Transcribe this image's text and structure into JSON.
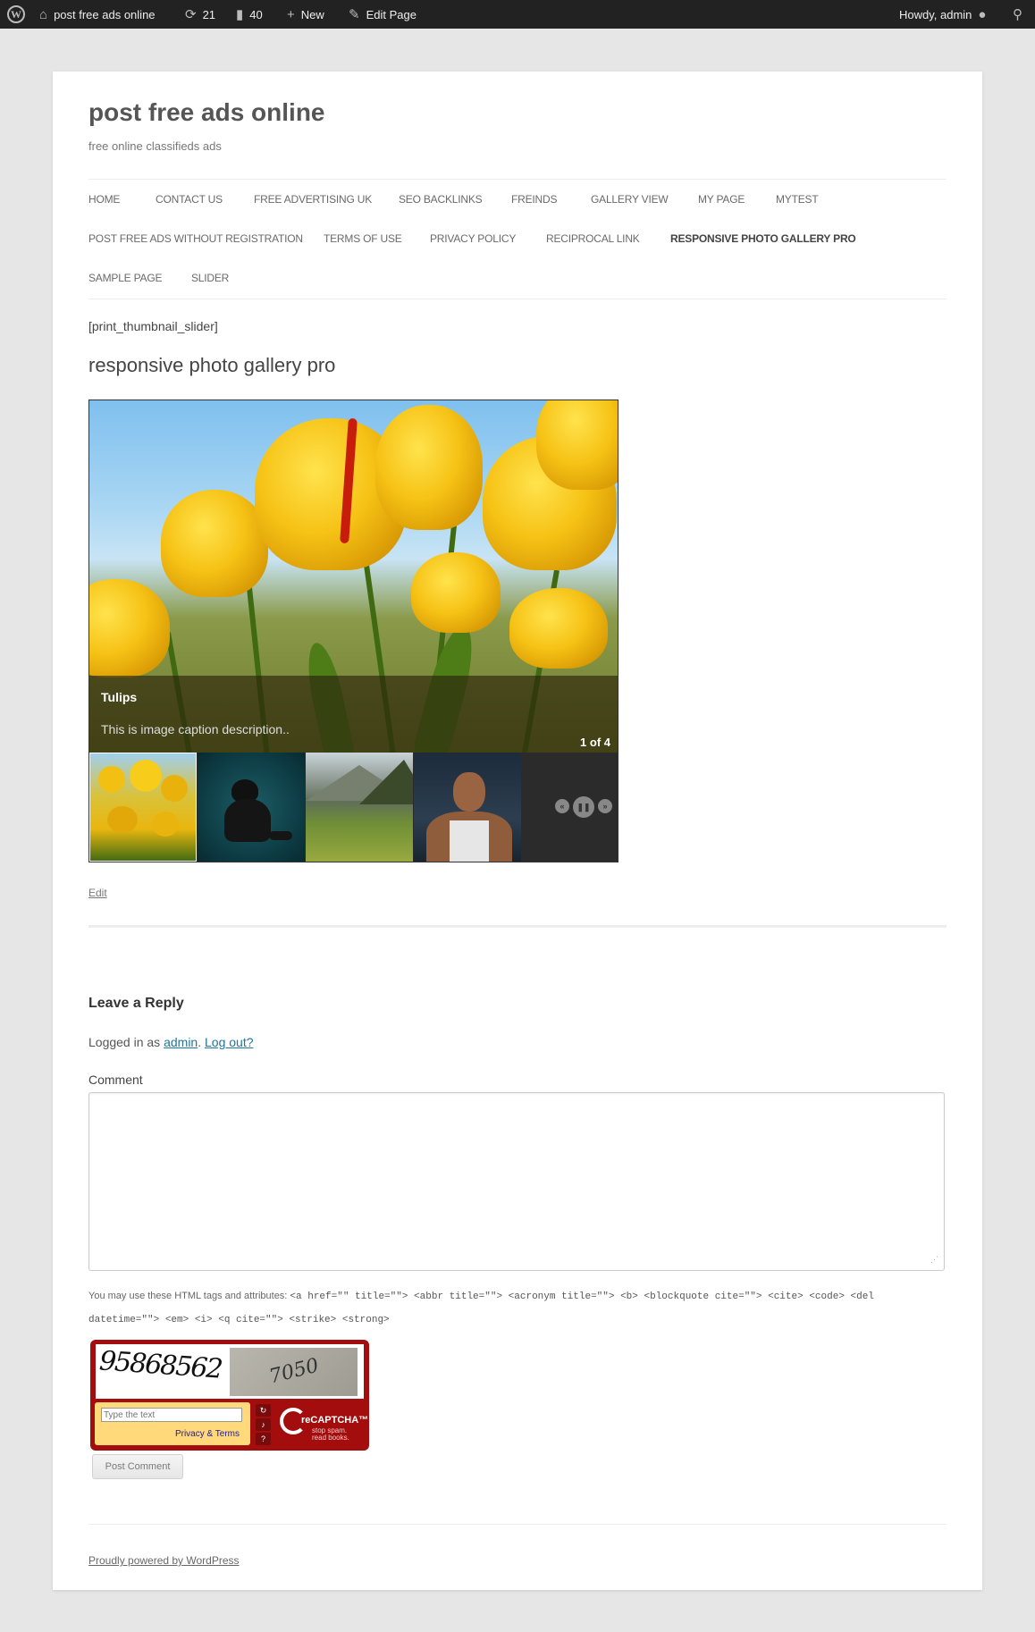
{
  "adminbar": {
    "site_name": "post free ads online",
    "updates_count": "21",
    "comments_count": "40",
    "new_label": "New",
    "edit_label": "Edit Page",
    "howdy": "Howdy, admin"
  },
  "site": {
    "title": "post free ads online",
    "description": "free online classifieds ads"
  },
  "nav": {
    "items": [
      "HOME",
      "CONTACT US",
      "FREE ADVERTISING UK",
      "SEO BACKLINKS",
      "FREINDS",
      "GALLERY VIEW",
      "MY PAGE",
      "MYTEST",
      "POST FREE ADS WITHOUT REGISTRATION",
      "TERMS OF USE",
      "PRIVACY POLICY",
      "RECIPROCAL LINK",
      "RESPONSIVE PHOTO GALLERY PRO",
      "SAMPLE PAGE",
      "SLIDER"
    ],
    "current": "RESPONSIVE PHOTO GALLERY PRO"
  },
  "content": {
    "shortcode": "[print_thumbnail_slider]",
    "entry_title": "responsive photo gallery pro",
    "edit_link": "Edit"
  },
  "gallery": {
    "caption_title": "Tulips",
    "caption_desc": "This is image caption description..",
    "counter": "1 of 4",
    "current_index": 1,
    "total": 4,
    "thumbnails": [
      "tulips",
      "cat",
      "mountain-meadow",
      "man"
    ]
  },
  "reply": {
    "title": "Leave a Reply",
    "logged_prefix": "Logged in as ",
    "user": "admin",
    "logout": "Log out?",
    "comment_label": "Comment",
    "allowed_prefix": "You may use these HTML tags and attributes: ",
    "allowed_code": "<a href=\"\" title=\"\"> <abbr title=\"\"> <acronym title=\"\"> <b> <blockquote cite=\"\"> <cite> <code> <del datetime=\"\"> <em> <i> <q cite=\"\"> <strike> <strong>",
    "post_button": "Post Comment"
  },
  "captcha": {
    "word1": "95868562",
    "word2": "7050",
    "input_placeholder": "Type the text",
    "privacy": "Privacy & Terms",
    "brand": "reCAPTCHA™",
    "slogan_line1": "stop spam.",
    "slogan_line2": "read books."
  },
  "footer": {
    "credit": "Proudly powered by WordPress"
  }
}
